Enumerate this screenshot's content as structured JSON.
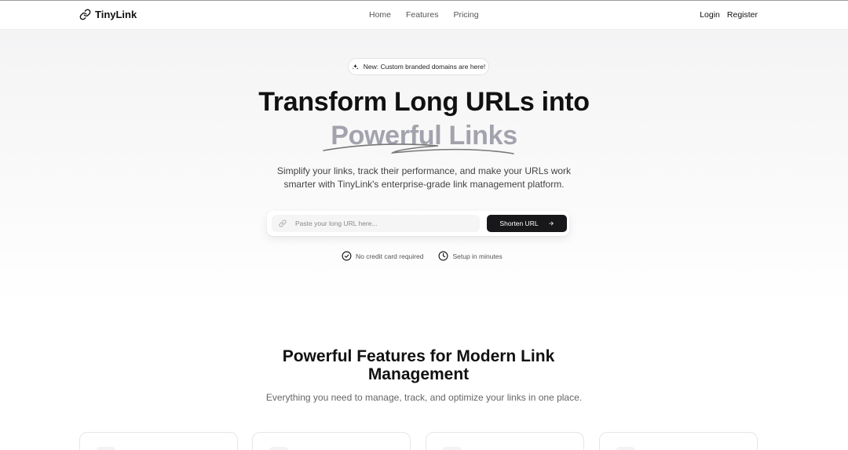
{
  "header": {
    "brand": "TinyLink",
    "nav": [
      "Home",
      "Features",
      "Pricing"
    ],
    "auth": {
      "login": "Login",
      "register": "Register"
    }
  },
  "hero": {
    "badge": "New: Custom branded domains are here!",
    "title_line1": "Transform Long URLs into",
    "title_line2": "Powerful Links",
    "subtitle": "Simplify your links, track their performance, and make your URLs work smarter with TinyLink's enterprise-grade link management platform.",
    "url_placeholder": "Paste your long URL here...",
    "url_value": "",
    "shorten_label": "Shorten URL",
    "perks": [
      "No credit card required",
      "Setup in minutes"
    ]
  },
  "features": {
    "title": "Powerful Features for Modern Link Management",
    "subtitle": "Everything you need to manage, track, and optimize your links in one place."
  },
  "colors": {
    "accent_dark": "#18181b",
    "accent_text_muted": "#a3a3ad"
  }
}
